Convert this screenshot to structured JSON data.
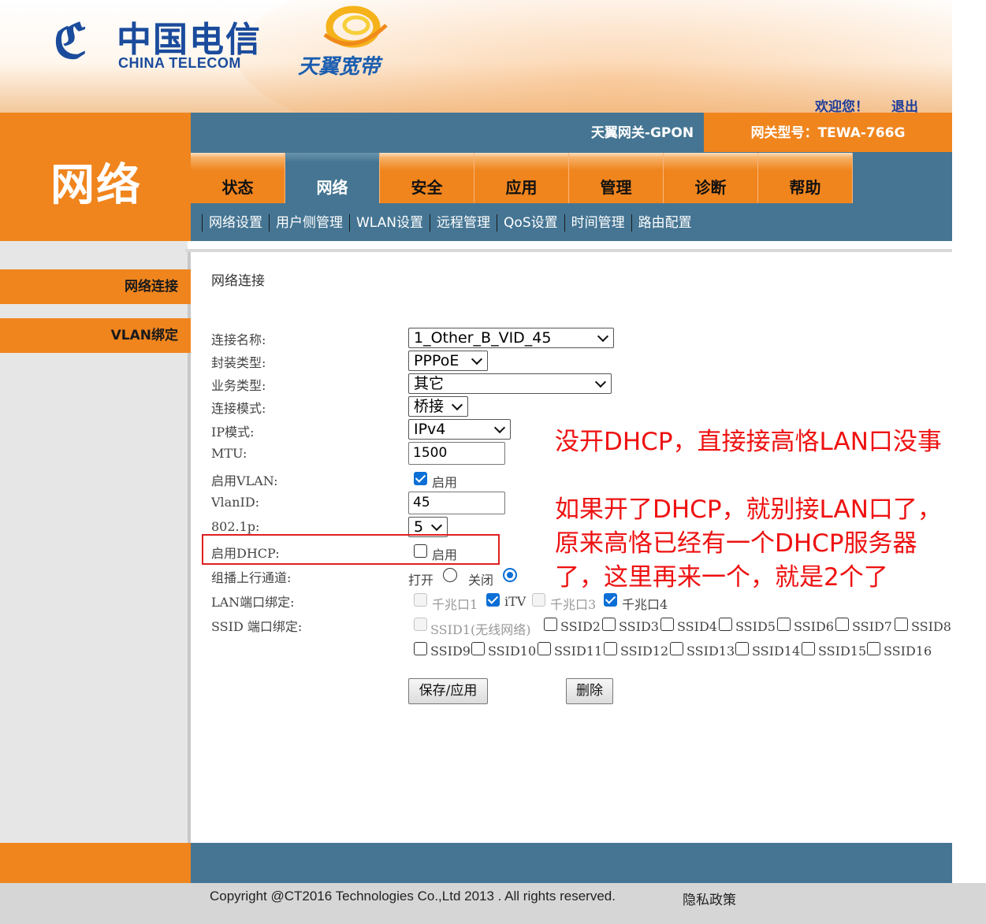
{
  "header": {
    "logo_cn": "中国电信",
    "logo_en": "CHINA TELECOM",
    "brand": "天翼宽带",
    "welcome": "欢迎您！",
    "logout": "退出"
  },
  "section_title": "网络",
  "gateway_name": "天翼网关-GPON",
  "gateway_model": "网关型号：TEWA-766G",
  "tabs": [
    {
      "label": "状态"
    },
    {
      "label": "网络"
    },
    {
      "label": "安全"
    },
    {
      "label": "应用"
    },
    {
      "label": "管理"
    },
    {
      "label": "诊断"
    },
    {
      "label": "帮助"
    }
  ],
  "active_tab": "网络",
  "subnav": [
    "网络设置",
    "用户侧管理",
    "WLAN设置",
    "远程管理",
    "QoS设置",
    "时间管理",
    "路由配置"
  ],
  "sidebar": [
    {
      "label": "网络连接"
    },
    {
      "label": "VLAN绑定"
    }
  ],
  "form": {
    "title": "网络连接",
    "labels": {
      "conn_name": "连接名称:",
      "encap": "封装类型:",
      "service": "业务类型:",
      "mode": "连接模式:",
      "ipmode": "IP模式:",
      "mtu": "MTU:",
      "vlan_enable": "启用VLAN:",
      "vlan_id": "VlanID:",
      "dot1p": "802.1p:",
      "dhcp": "启用DHCP:",
      "multicast": "组播上行通道:",
      "lan_bind": "LAN端口绑定:",
      "ssid_bind": "SSID 端口绑定:"
    },
    "values": {
      "conn_name": "1_Other_B_VID_45",
      "encap": "PPPoE",
      "service": "其它",
      "mode": "桥接",
      "ipmode": "IPv4",
      "mtu": "1500",
      "vlan_id": "45",
      "dot1p": "5"
    },
    "vlan_enable": {
      "label": "启用",
      "checked": true
    },
    "dhcp": {
      "label": "启用",
      "checked": false
    },
    "multicast": {
      "open": "打开",
      "close": "关闭",
      "selected": "关闭"
    },
    "lan_ports": [
      {
        "label": "千兆口1",
        "checked": false,
        "disabled": true
      },
      {
        "label": "iTV",
        "checked": true,
        "disabled": false
      },
      {
        "label": "千兆口3",
        "checked": false,
        "disabled": true
      },
      {
        "label": "千兆口4",
        "checked": true,
        "disabled": false
      }
    ],
    "ssids": [
      {
        "label": "SSID1(无线网络)",
        "checked": false,
        "disabled": true
      },
      {
        "label": "SSID2",
        "checked": false
      },
      {
        "label": "SSID3",
        "checked": false
      },
      {
        "label": "SSID4",
        "checked": false
      },
      {
        "label": "SSID5",
        "checked": false
      },
      {
        "label": "SSID6",
        "checked": false
      },
      {
        "label": "SSID7",
        "checked": false
      },
      {
        "label": "SSID8",
        "checked": false
      },
      {
        "label": "SSID9",
        "checked": false
      },
      {
        "label": "SSID10",
        "checked": false
      },
      {
        "label": "SSID11",
        "checked": false
      },
      {
        "label": "SSID12",
        "checked": false
      },
      {
        "label": "SSID13",
        "checked": false
      },
      {
        "label": "SSID14",
        "checked": false
      },
      {
        "label": "SSID15",
        "checked": false
      },
      {
        "label": "SSID16",
        "checked": false
      }
    ],
    "save_button": "保存/应用",
    "delete_button": "删除"
  },
  "annotations": {
    "line1": "没开DHCP，直接接高恪LAN口没事",
    "line2": "如果开了DHCP，就别接LAN口了，",
    "line3": "原来高恪已经有一个DHCP服务器",
    "line4": "了，这里再来一个，就是2个了",
    "color": "#ee1111"
  },
  "footer": {
    "copyright": "Copyright @CT2016 Technologies Co.,Ltd 2013 . All rights reserved.",
    "privacy": "隐私政策"
  },
  "colors": {
    "orange": "#f0851e",
    "steel_blue": "#457593",
    "brand_blue": "#1b4b9c"
  }
}
